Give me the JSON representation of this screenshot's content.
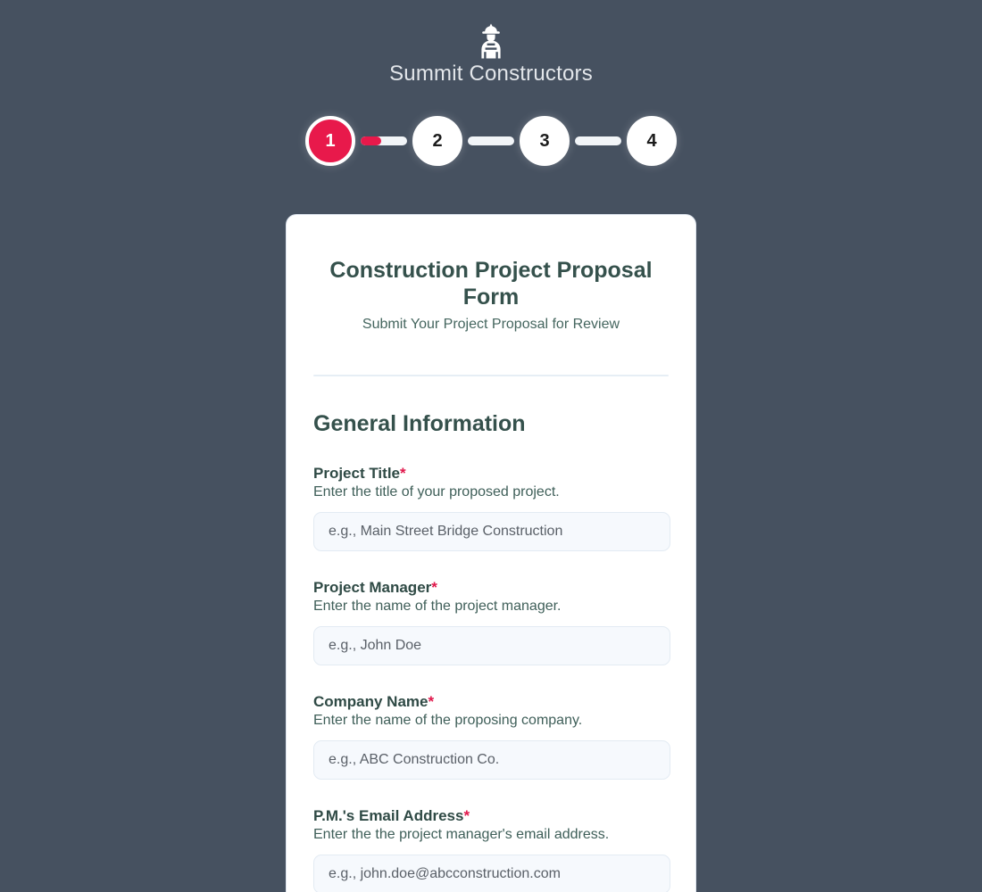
{
  "brand": {
    "name": "Summit Constructors",
    "logo_icon": "construction-worker-icon"
  },
  "stepper": {
    "current_step": 1,
    "progress_percent": 45,
    "steps": [
      {
        "label": "1",
        "state": "active"
      },
      {
        "label": "2",
        "state": "inactive"
      },
      {
        "label": "3",
        "state": "inactive"
      },
      {
        "label": "4",
        "state": "inactive"
      }
    ]
  },
  "card": {
    "title": "Construction Project Proposal Form",
    "subtitle": "Submit Your Project Proposal for Review",
    "section_title": "General Information",
    "fields": [
      {
        "label": "Project Title",
        "required_marker": "*",
        "help": "Enter the title of your proposed project.",
        "placeholder": "e.g., Main Street Bridge Construction",
        "value": ""
      },
      {
        "label": "Project Manager",
        "required_marker": "*",
        "help": "Enter the name of the project manager.",
        "placeholder": "e.g., John Doe",
        "value": ""
      },
      {
        "label": "Company Name",
        "required_marker": "*",
        "help": "Enter the name of the proposing company.",
        "placeholder": "e.g., ABC Construction Co.",
        "value": ""
      },
      {
        "label": "P.M.'s Email Address",
        "required_marker": "*",
        "help": "Enter the the project manager's email address.",
        "placeholder": "e.g., john.doe@abcconstruction.com",
        "value": ""
      }
    ]
  },
  "colors": {
    "page_background": "#465160",
    "accent": "#e8194b",
    "heading": "#35514c",
    "card_background": "#ffffff",
    "input_background": "#f6f9fd"
  }
}
